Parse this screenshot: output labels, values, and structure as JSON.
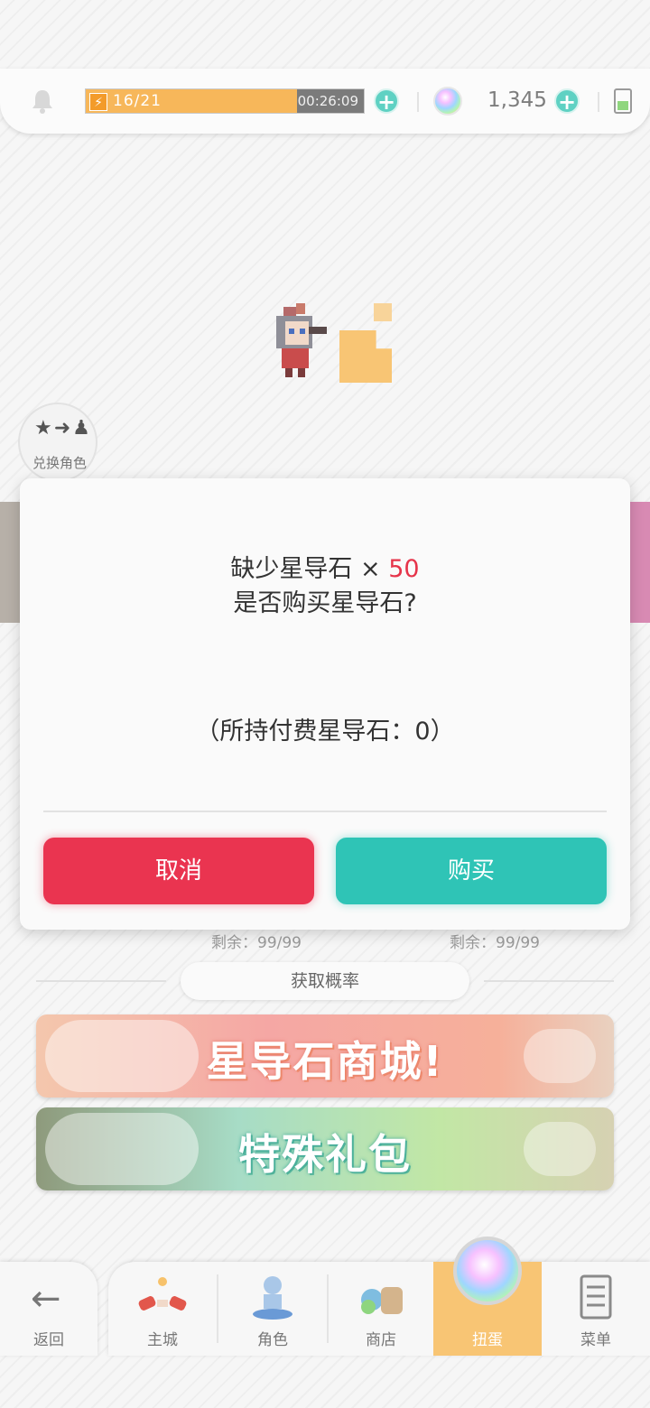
{
  "status_bar": {
    "stamina_text": "16/21",
    "stamina_fraction": 0.76,
    "stamina_timer": "00:26:09",
    "gem_count": "1,345"
  },
  "scene": {
    "swap_label": "兑换角色",
    "left_remaining": "剩余：99/99",
    "right_remaining": "剩余：99/99",
    "rate_button": "获取概率",
    "promo_shop_text": "星导石商城!",
    "promo_gift_text": "特殊礼包"
  },
  "dialog": {
    "line1_prefix": "缺少星导石 × ",
    "line1_count": "50",
    "line2": "是否购买星导石?",
    "holding": "（所持付费星导石：0）",
    "cancel_label": "取消",
    "buy_label": "购买"
  },
  "nav": {
    "back_label": "返回",
    "items": [
      {
        "label": "主城",
        "icon": "castle-icon"
      },
      {
        "label": "角色",
        "icon": "character-icon"
      },
      {
        "label": "商店",
        "icon": "shop-icon"
      },
      {
        "label": "扭蛋",
        "icon": "gacha-icon",
        "active": true
      },
      {
        "label": "菜单",
        "icon": "menu-icon"
      }
    ]
  },
  "colors": {
    "accent_red": "#ea3450",
    "accent_teal": "#2fc4b6",
    "stamina_orange": "#f7b75a",
    "active_tab": "#f8c574"
  }
}
